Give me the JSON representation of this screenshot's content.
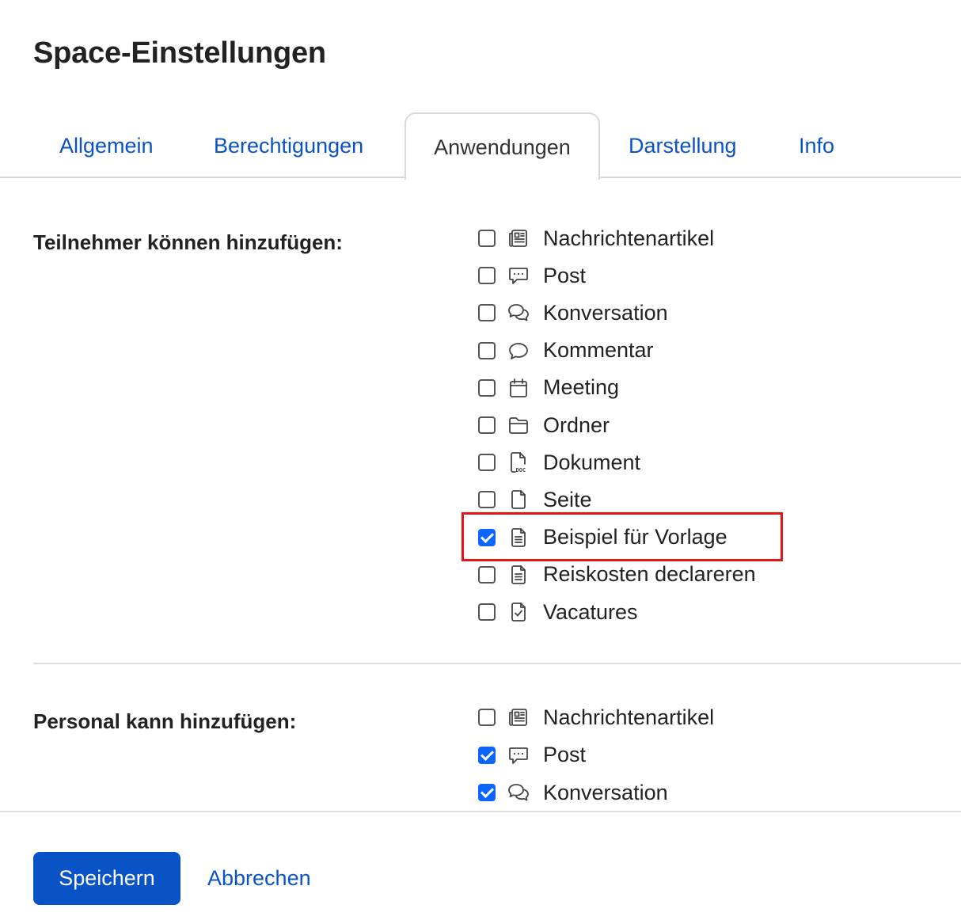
{
  "dialog": {
    "title": "Space-Einstellungen"
  },
  "tabs": [
    {
      "label": "Allgemein",
      "active": false
    },
    {
      "label": "Berechtigungen",
      "active": false
    },
    {
      "label": "Anwendungen",
      "active": true
    },
    {
      "label": "Darstellung",
      "active": false
    },
    {
      "label": "Info",
      "active": false
    }
  ],
  "participants": {
    "label": "Teilnehmer können hinzufügen:",
    "options": [
      {
        "label": "Nachrichtenartikel",
        "icon": "newspaper-icon",
        "checked": false
      },
      {
        "label": "Post",
        "icon": "chat-bubble-dots-icon",
        "checked": false
      },
      {
        "label": "Konversation",
        "icon": "conversation-icon",
        "checked": false
      },
      {
        "label": "Kommentar",
        "icon": "comment-icon",
        "checked": false
      },
      {
        "label": "Meeting",
        "icon": "calendar-icon",
        "checked": false
      },
      {
        "label": "Ordner",
        "icon": "folder-icon",
        "checked": false
      },
      {
        "label": "Dokument",
        "icon": "document-doc-icon",
        "checked": false
      },
      {
        "label": "Seite",
        "icon": "page-icon",
        "checked": false
      },
      {
        "label": "Beispiel für Vorlage",
        "icon": "template-document-icon",
        "checked": true
      },
      {
        "label": "Reiskosten declareren",
        "icon": "template-document-icon",
        "checked": false
      },
      {
        "label": "Vacatures",
        "icon": "checklist-document-icon",
        "checked": false
      }
    ]
  },
  "staff": {
    "label": "Personal kann hinzufügen:",
    "options": [
      {
        "label": "Nachrichtenartikel",
        "icon": "newspaper-icon",
        "checked": false
      },
      {
        "label": "Post",
        "icon": "chat-bubble-dots-icon",
        "checked": true
      },
      {
        "label": "Konversation",
        "icon": "conversation-icon",
        "checked": true
      }
    ]
  },
  "footer": {
    "save_label": "Speichern",
    "cancel_label": "Abbrechen"
  },
  "colors": {
    "accent": "#0a53c6",
    "checkbox": "#0a66ff",
    "highlight": "#e51515"
  }
}
